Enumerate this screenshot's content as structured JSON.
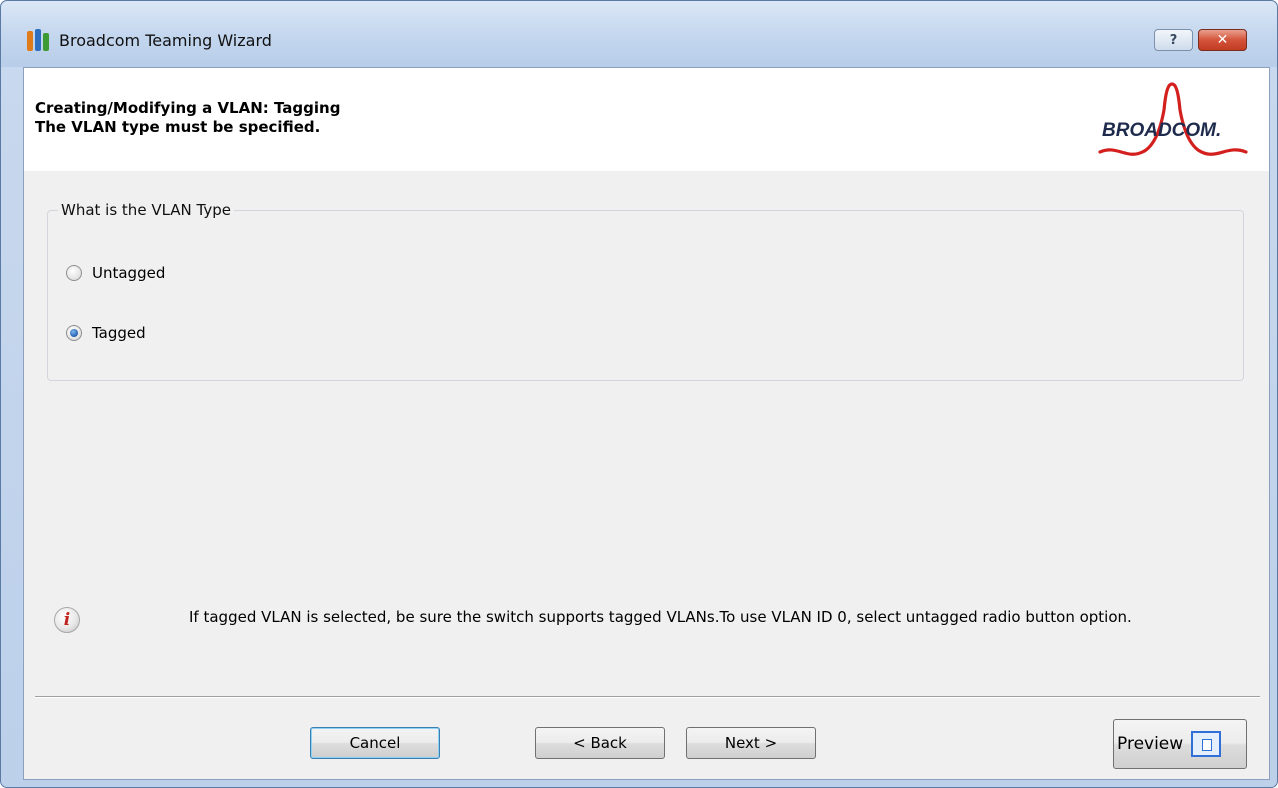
{
  "window": {
    "title": "Broadcom Teaming Wizard",
    "help_label": "?",
    "close_label": "✕"
  },
  "header": {
    "title": "Creating/Modifying a VLAN:  Tagging",
    "subtitle": "The VLAN type must be specified.",
    "logo_text": "BROADCOM."
  },
  "vlan_type_group": {
    "legend": "What is the VLAN Type",
    "options": [
      {
        "label": "Untagged",
        "selected": false
      },
      {
        "label": "Tagged",
        "selected": true
      }
    ]
  },
  "info": {
    "icon": "info-icon",
    "text": "If tagged VLAN is selected, be sure the switch supports tagged VLANs.To use VLAN ID 0, select untagged radio button option."
  },
  "buttons": {
    "cancel": "Cancel",
    "back": "< Back",
    "next": "Next >",
    "preview": "Preview"
  },
  "colors": {
    "accent": "#1f5fae",
    "logo_red": "#d3201f",
    "logo_navy": "#1f2b4d"
  }
}
